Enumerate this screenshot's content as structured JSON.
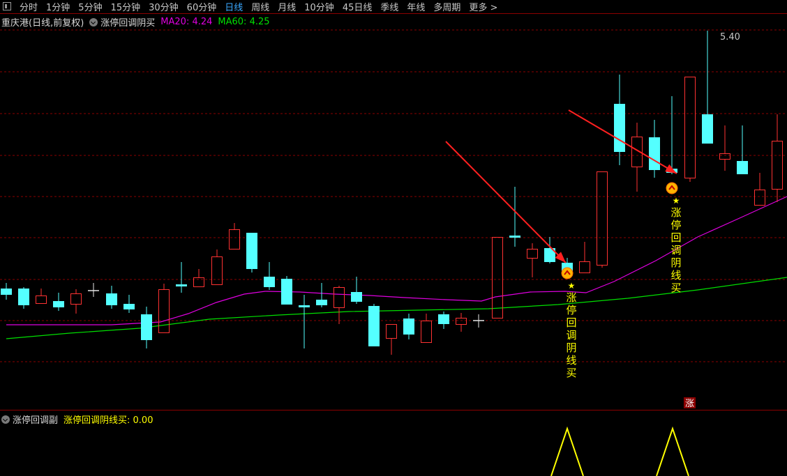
{
  "toolbar": {
    "tabs": [
      {
        "label": "分时"
      },
      {
        "label": "1分钟"
      },
      {
        "label": "5分钟"
      },
      {
        "label": "15分钟"
      },
      {
        "label": "30分钟"
      },
      {
        "label": "60分钟"
      },
      {
        "label": "日线",
        "active": true
      },
      {
        "label": "周线"
      },
      {
        "label": "月线"
      },
      {
        "label": "10分钟"
      },
      {
        "label": "45日线"
      },
      {
        "label": "季线"
      },
      {
        "label": "年线"
      },
      {
        "label": "多周期"
      },
      {
        "label": "更多 >"
      }
    ]
  },
  "main_legend": {
    "stock": "重庆港(日线,前复权)",
    "indicator": "涨停回调阴买",
    "ma20": "MA20: 4.24",
    "ma60": "MA60: 4.25"
  },
  "sub_legend": {
    "name": "涨停回调副",
    "value": "涨停回调阴线买: 0.00"
  },
  "annotations": {
    "high_label": "5.40",
    "signal_text": "涨停回调阴线买",
    "star": "★",
    "limit_badge": "涨"
  },
  "colors": {
    "up": "#ff3232",
    "down": "#54ffff",
    "ma20": "#e000e0",
    "ma60": "#00e000",
    "signal": "#ffff00",
    "arrow": "#ff2020",
    "grid": "#8b0000"
  },
  "chart_data": {
    "type": "candlestick",
    "series": [
      {
        "name": "MA20",
        "value": 4.24
      },
      {
        "name": "MA60",
        "value": 4.25
      }
    ],
    "high_marker": 5.4,
    "signal_values": [
      0,
      1,
      0,
      1,
      0
    ]
  }
}
